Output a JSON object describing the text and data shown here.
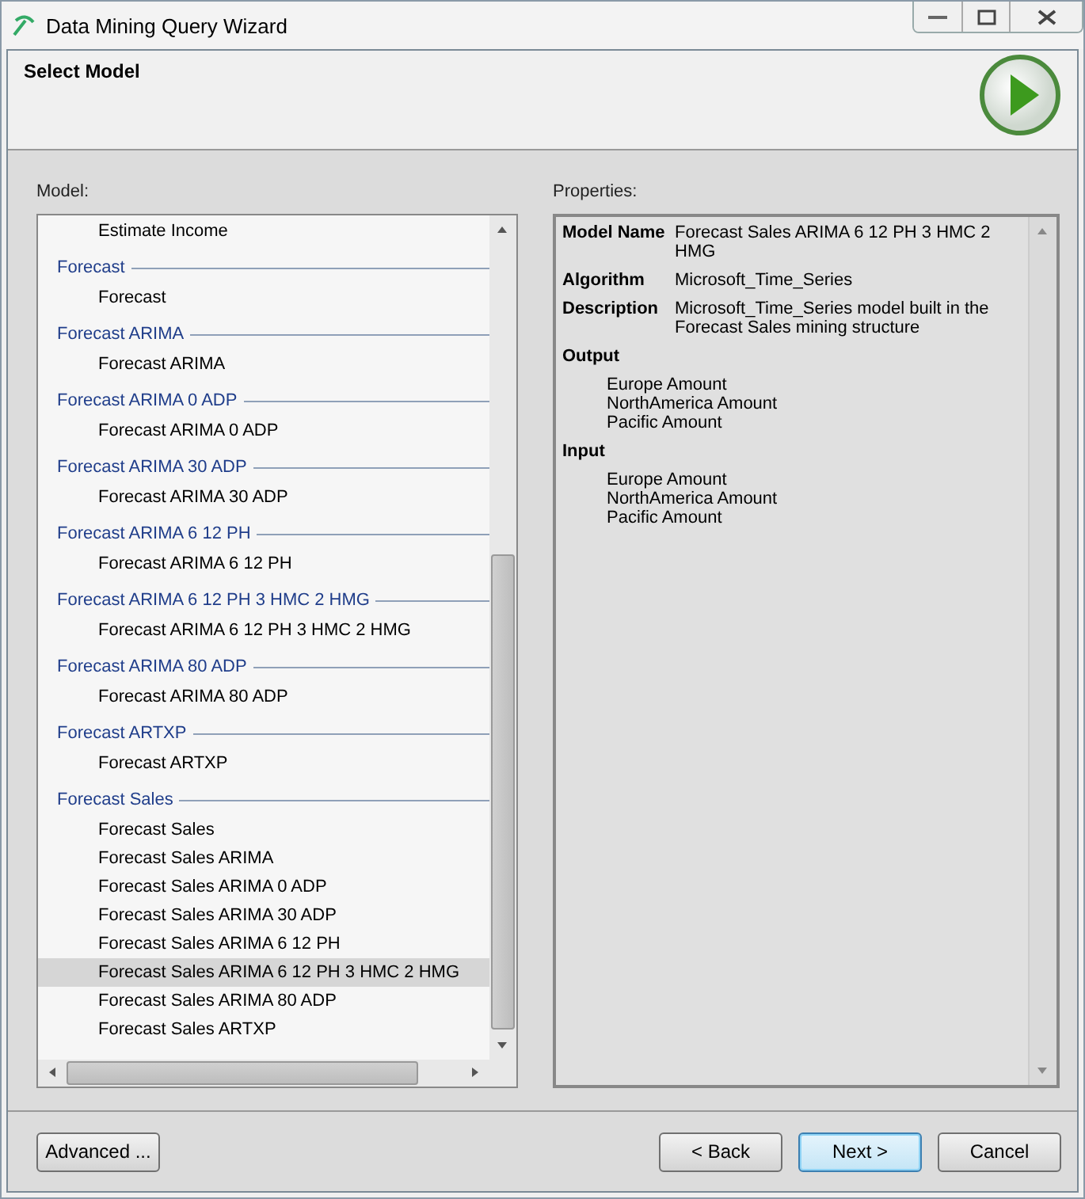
{
  "window": {
    "title": "Data Mining Query Wizard"
  },
  "header": {
    "title": "Select Model"
  },
  "model": {
    "label": "Model:",
    "groups": [
      {
        "children": [
          {
            "name": "Estimate Income",
            "selected": false
          }
        ]
      },
      {
        "name": "Forecast",
        "children": [
          {
            "name": "Forecast",
            "selected": false
          }
        ]
      },
      {
        "name": "Forecast ARIMA",
        "children": [
          {
            "name": "Forecast ARIMA",
            "selected": false
          }
        ]
      },
      {
        "name": "Forecast ARIMA 0 ADP",
        "children": [
          {
            "name": "Forecast ARIMA 0 ADP",
            "selected": false
          }
        ]
      },
      {
        "name": "Forecast ARIMA 30 ADP",
        "children": [
          {
            "name": "Forecast ARIMA 30 ADP",
            "selected": false
          }
        ]
      },
      {
        "name": "Forecast ARIMA 6 12 PH",
        "children": [
          {
            "name": "Forecast ARIMA 6 12 PH",
            "selected": false
          }
        ]
      },
      {
        "name": "Forecast ARIMA 6 12 PH 3 HMC 2 HMG",
        "children": [
          {
            "name": "Forecast ARIMA 6 12 PH 3 HMC 2 HMG",
            "selected": false
          }
        ]
      },
      {
        "name": "Forecast ARIMA 80 ADP",
        "children": [
          {
            "name": "Forecast ARIMA 80 ADP",
            "selected": false
          }
        ]
      },
      {
        "name": "Forecast ARTXP",
        "children": [
          {
            "name": "Forecast ARTXP",
            "selected": false
          }
        ]
      },
      {
        "name": "Forecast Sales",
        "children": [
          {
            "name": "Forecast Sales",
            "selected": false
          },
          {
            "name": "Forecast Sales ARIMA",
            "selected": false
          },
          {
            "name": "Forecast Sales ARIMA 0 ADP",
            "selected": false
          },
          {
            "name": "Forecast Sales ARIMA 30 ADP",
            "selected": false
          },
          {
            "name": "Forecast Sales ARIMA 6 12 PH",
            "selected": false
          },
          {
            "name": "Forecast Sales ARIMA 6 12 PH 3 HMC 2 HMG",
            "selected": true
          },
          {
            "name": "Forecast Sales ARIMA 80 ADP",
            "selected": false
          },
          {
            "name": "Forecast Sales ARTXP",
            "selected": false
          }
        ]
      }
    ]
  },
  "properties": {
    "label": "Properties:",
    "fields": [
      {
        "name": "Model Name",
        "value": "Forecast Sales ARIMA 6 12 PH 3 HMC 2 HMG"
      },
      {
        "name": "Algorithm",
        "value": "Microsoft_Time_Series"
      },
      {
        "name": "Description",
        "value": "Microsoft_Time_Series model built in the Forecast Sales mining structure"
      }
    ],
    "sections": [
      {
        "title": "Output",
        "items": [
          "Europe Amount",
          "NorthAmerica Amount",
          "Pacific Amount"
        ]
      },
      {
        "title": "Input",
        "items": [
          "Europe Amount",
          "NorthAmerica Amount",
          "Pacific Amount"
        ]
      }
    ]
  },
  "buttons": {
    "left": [
      "Advanced ..."
    ],
    "right": [
      {
        "label": "< Back",
        "default": false
      },
      {
        "label": "Next >",
        "default": true
      },
      {
        "label": "Cancel",
        "default": false
      }
    ]
  }
}
